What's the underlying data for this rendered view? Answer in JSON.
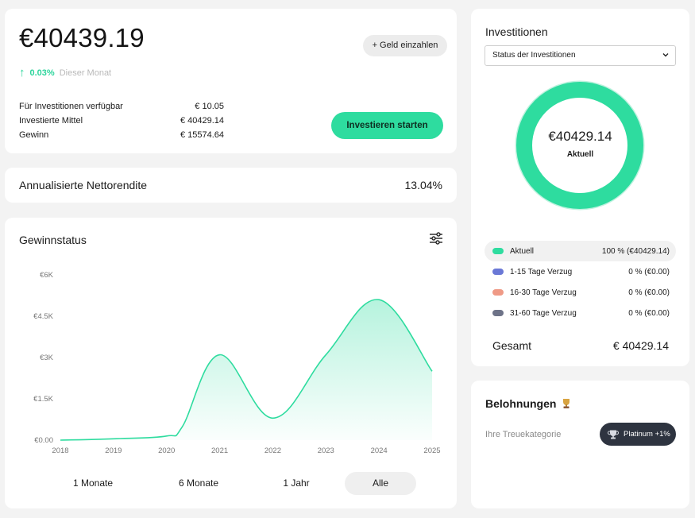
{
  "balance": {
    "amount": "€40439.19",
    "deposit_label": "+ Geld einzahlen",
    "change_value": "0.03%",
    "change_label": "Dieser Monat",
    "stats": [
      {
        "label": "Für Investitionen verfügbar",
        "value": "€ 10.05"
      },
      {
        "label": "Investierte Mittel",
        "value": "€ 40429.14"
      },
      {
        "label": "Gewinn",
        "value": "€ 15574.64"
      }
    ],
    "invest_button": "Investieren starten"
  },
  "annual_return": {
    "label": "Annualisierte Nettorendite",
    "value": "13.04%"
  },
  "profit_chart": {
    "title": "Gewinnstatus",
    "periods": [
      "1 Monate",
      "6 Monate",
      "1 Jahr",
      "Alle"
    ],
    "active_period": "Alle"
  },
  "chart_data": {
    "type": "area",
    "title": "Gewinnstatus",
    "x": [
      2018,
      2019,
      2020,
      2020.3,
      2021,
      2022,
      2023,
      2024,
      2025
    ],
    "values": [
      0,
      50,
      150,
      500,
      3100,
      800,
      3100,
      5100,
      2500
    ],
    "x_ticks": [
      "2018",
      "2019",
      "2020",
      "2021",
      "2022",
      "2023",
      "2024",
      "2025"
    ],
    "y_ticks": [
      "€0.00",
      "€1.5K",
      "€3K",
      "€4.5K",
      "€6K"
    ],
    "ylim": [
      0,
      6000
    ],
    "grid": false,
    "line_color": "#2edc9f"
  },
  "investments": {
    "title": "Investitionen",
    "select_value": "Status der Investitionen",
    "donut_value": "€40429.14",
    "donut_label": "Aktuell",
    "legend": [
      {
        "label": "Aktuell",
        "value": "100 % (€40429.14)",
        "color": "#2edc9f"
      },
      {
        "label": "1-15 Tage Verzug",
        "value": "0 % (€0.00)",
        "color": "#6a78d6"
      },
      {
        "label": "16-30 Tage Verzug",
        "value": "0 % (€0.00)",
        "color": "#ef9a86"
      },
      {
        "label": "31-60 Tage Verzug",
        "value": "0 % (€0.00)",
        "color": "#6e7388"
      }
    ],
    "total_label": "Gesamt",
    "total_value": "€ 40429.14"
  },
  "rewards": {
    "title": "Belohnungen",
    "tier_label": "Ihre Treuekategorie",
    "badge": "Platinum +1%"
  }
}
